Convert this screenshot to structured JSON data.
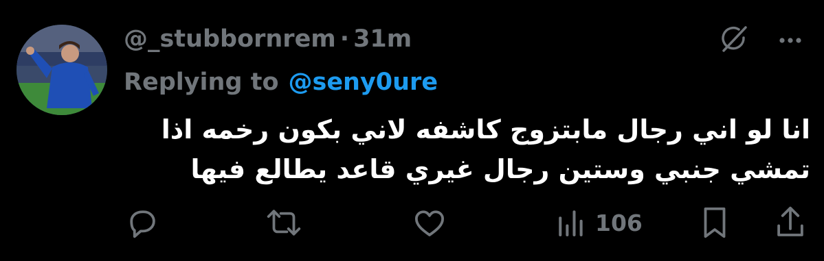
{
  "tweet": {
    "username": "@_stubbornrem",
    "separator": "·",
    "time": "31m",
    "replying_prefix": "Replying to",
    "replying_handle": "@seny0ure",
    "body_lines": [
      "انا لو اني رجال مابتزوج كاشفه لاني بكون رخمه اذا",
      "تمشي جنبي وستين رجال غيري قاعد يطالع فيها"
    ]
  },
  "stats": {
    "views": "106"
  },
  "icons": {
    "grok": "grok-icon",
    "more": "more-icon",
    "reply": "reply-icon",
    "retweet": "retweet-icon",
    "like": "like-icon",
    "views": "views-icon",
    "bookmark": "bookmark-icon",
    "share": "share-icon"
  },
  "colors": {
    "background": "#000000",
    "text": "#ffffff",
    "muted": "#71767b",
    "link": "#1d9bf0"
  }
}
